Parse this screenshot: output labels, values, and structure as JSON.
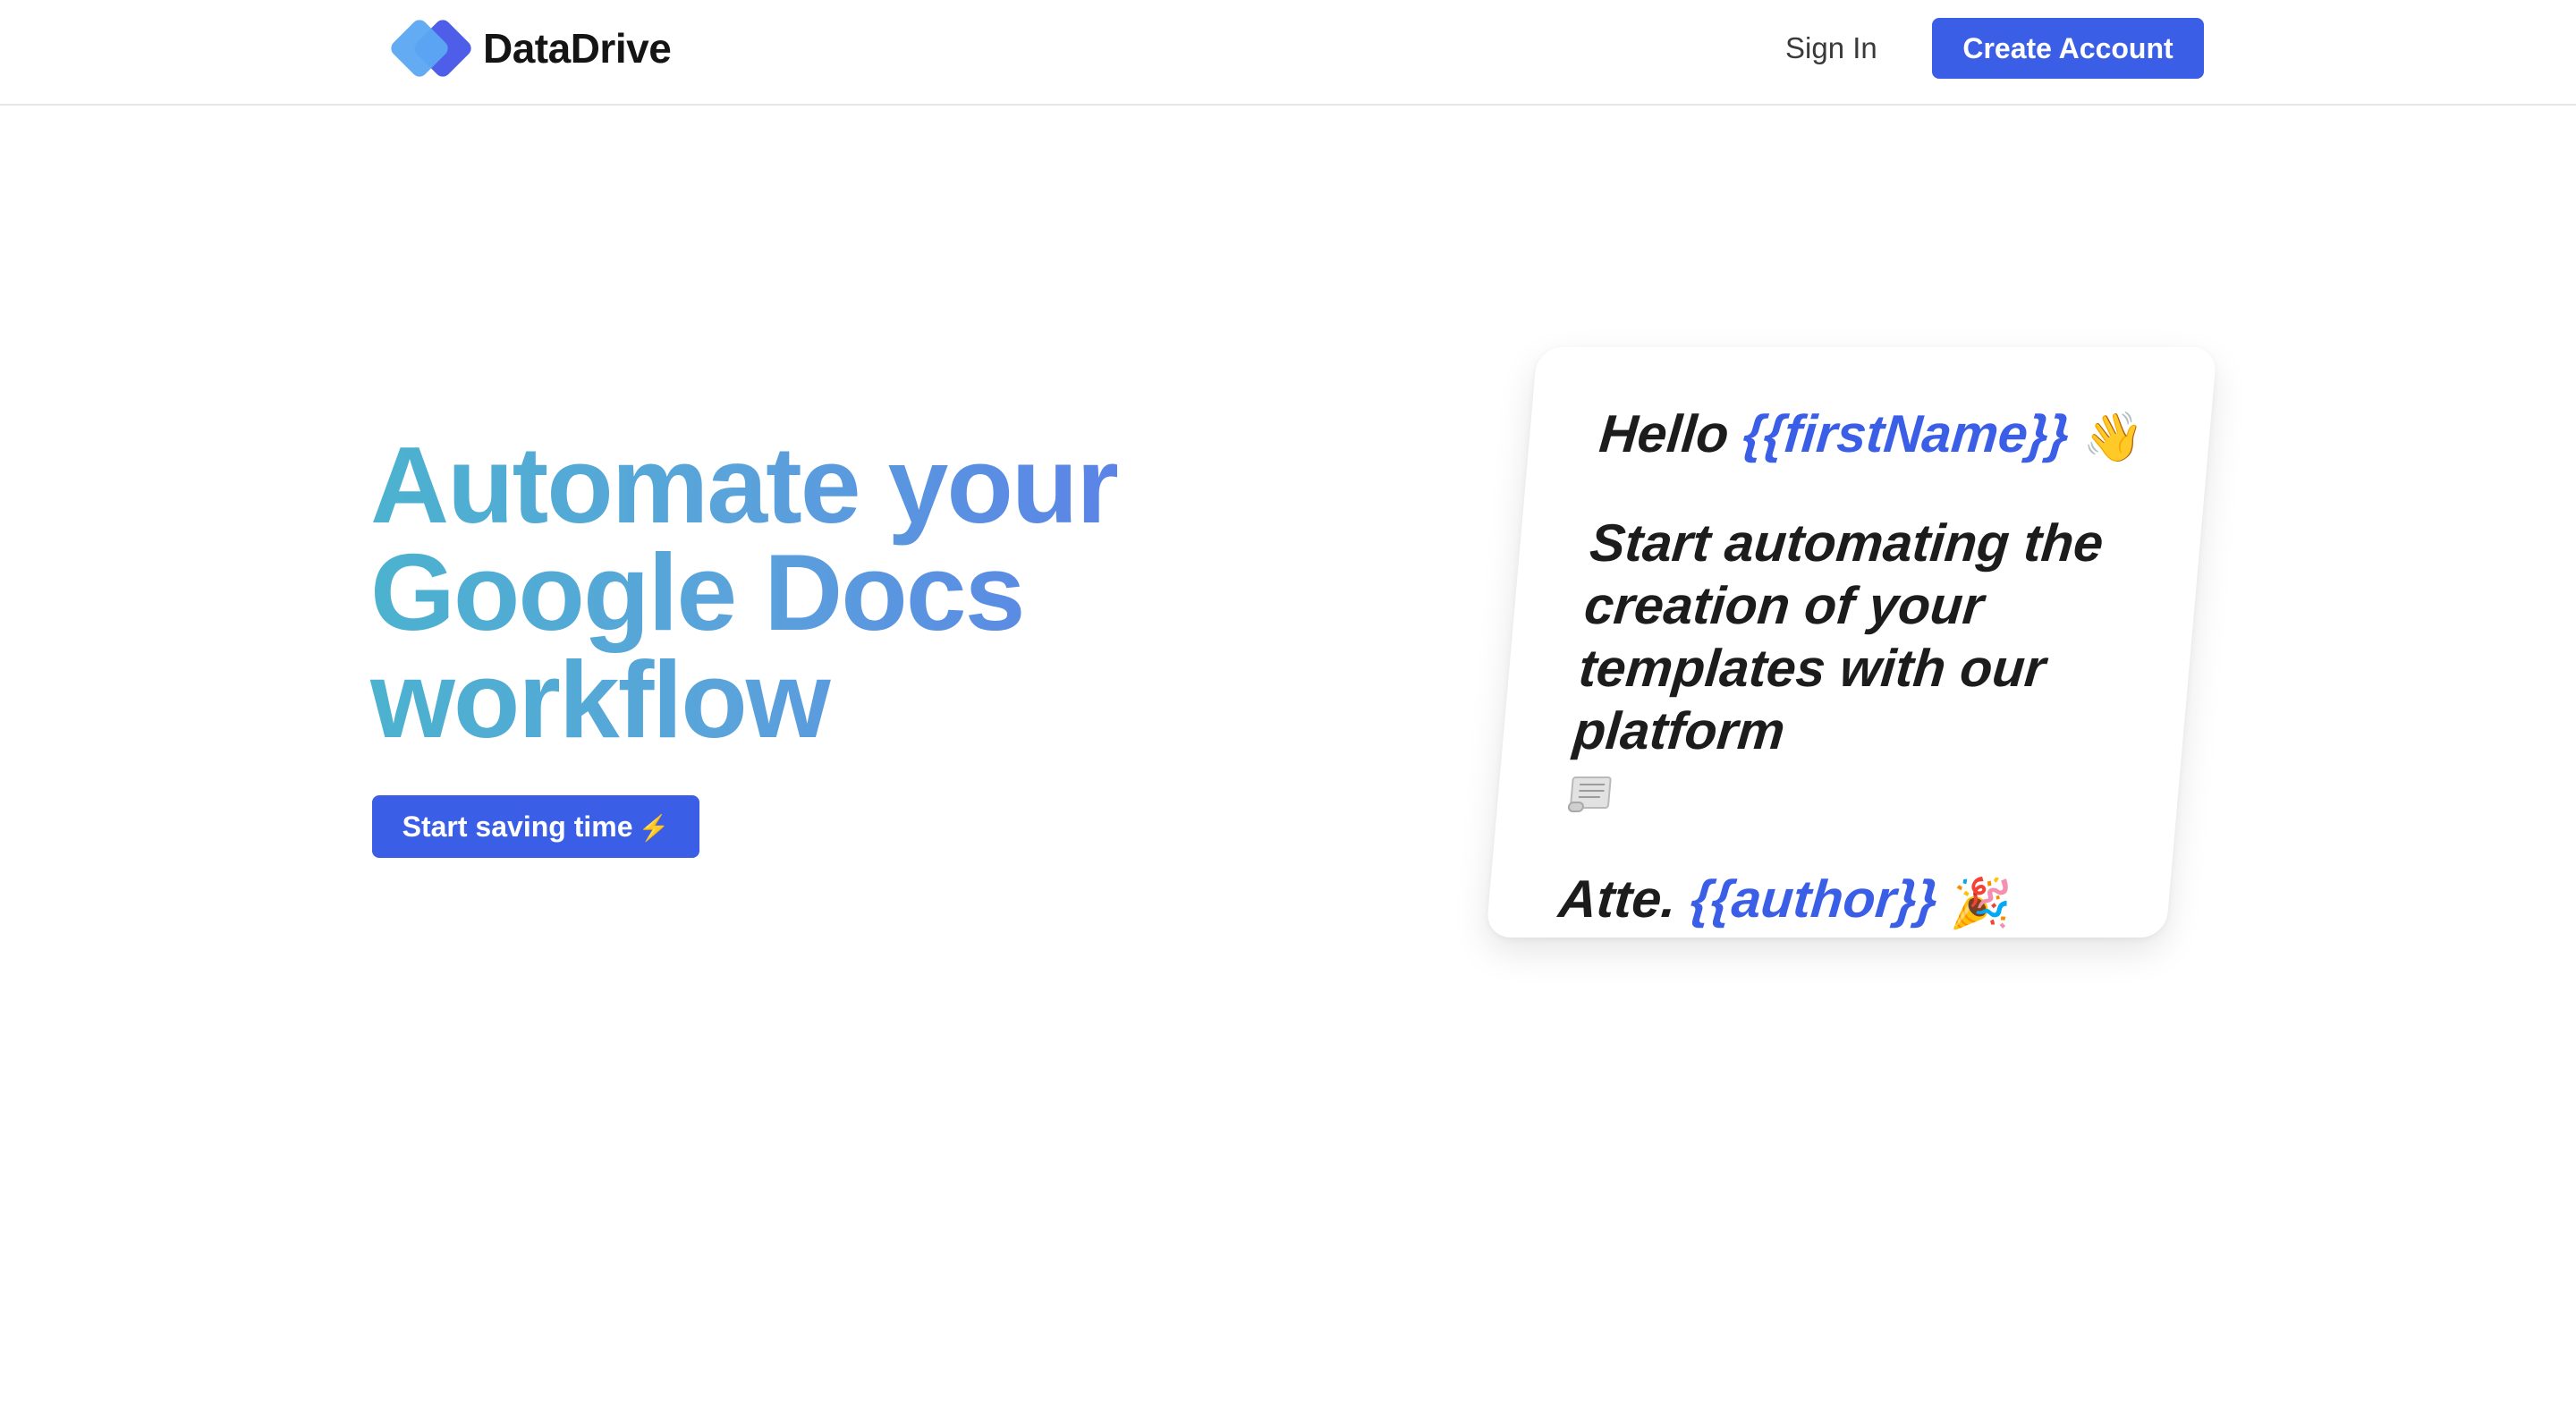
{
  "header": {
    "brand": "DataDrive",
    "sign_in": "Sign In",
    "create_account": "Create Account"
  },
  "hero": {
    "title_lines": [
      "Automate your",
      "Google Docs",
      "workflow"
    ],
    "cta_label": "Start saving time",
    "cta_icon": "lightning-icon"
  },
  "card": {
    "greeting": "Hello",
    "greeting_var": "{{firstName}}",
    "greeting_emoji": "waving-hand-icon",
    "body_lines": [
      "Start automating the",
      "creation of your",
      "templates with our",
      "platform"
    ],
    "body_emoji": "scroll-icon",
    "sign_prefix": "Atte.",
    "sign_var": "{{author}}",
    "sign_emoji": "party-popper-icon"
  },
  "colors": {
    "primary": "#3b5ee6",
    "gradient_start": "#4cb2cf",
    "gradient_end": "#5b7fe8",
    "text_dark": "#1c1c1c"
  }
}
